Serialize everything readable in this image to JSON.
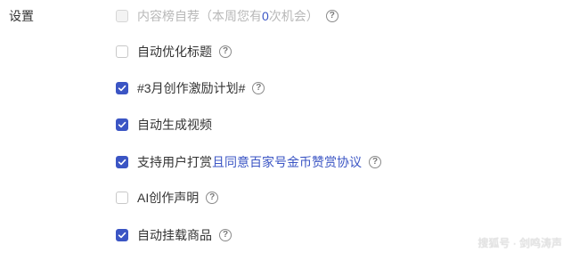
{
  "section": {
    "label": "设置"
  },
  "options": [
    {
      "label_before": "内容榜自荐（本周您有",
      "count": "0",
      "label_after": "次机会）",
      "checked": false,
      "disabled": true
    },
    {
      "label": "自动优化标题",
      "checked": false,
      "disabled": false
    },
    {
      "label": "#3月创作激励计划#",
      "checked": true,
      "disabled": false
    },
    {
      "label": "自动生成视频",
      "checked": true,
      "disabled": false
    },
    {
      "label": "支持用户打赏",
      "link_text": "且同意百家号金币赞赏协议",
      "checked": true,
      "disabled": false
    },
    {
      "label": "AI创作声明",
      "checked": false,
      "disabled": false
    },
    {
      "label": "自动挂载商品",
      "checked": true,
      "disabled": false
    }
  ],
  "help_icon": "help-question-icon",
  "watermark": "搜狐号 · 剑鸣涛声",
  "colors": {
    "accent": "#3b55c4",
    "text": "#333333",
    "disabled_text": "#b8b8b8"
  }
}
